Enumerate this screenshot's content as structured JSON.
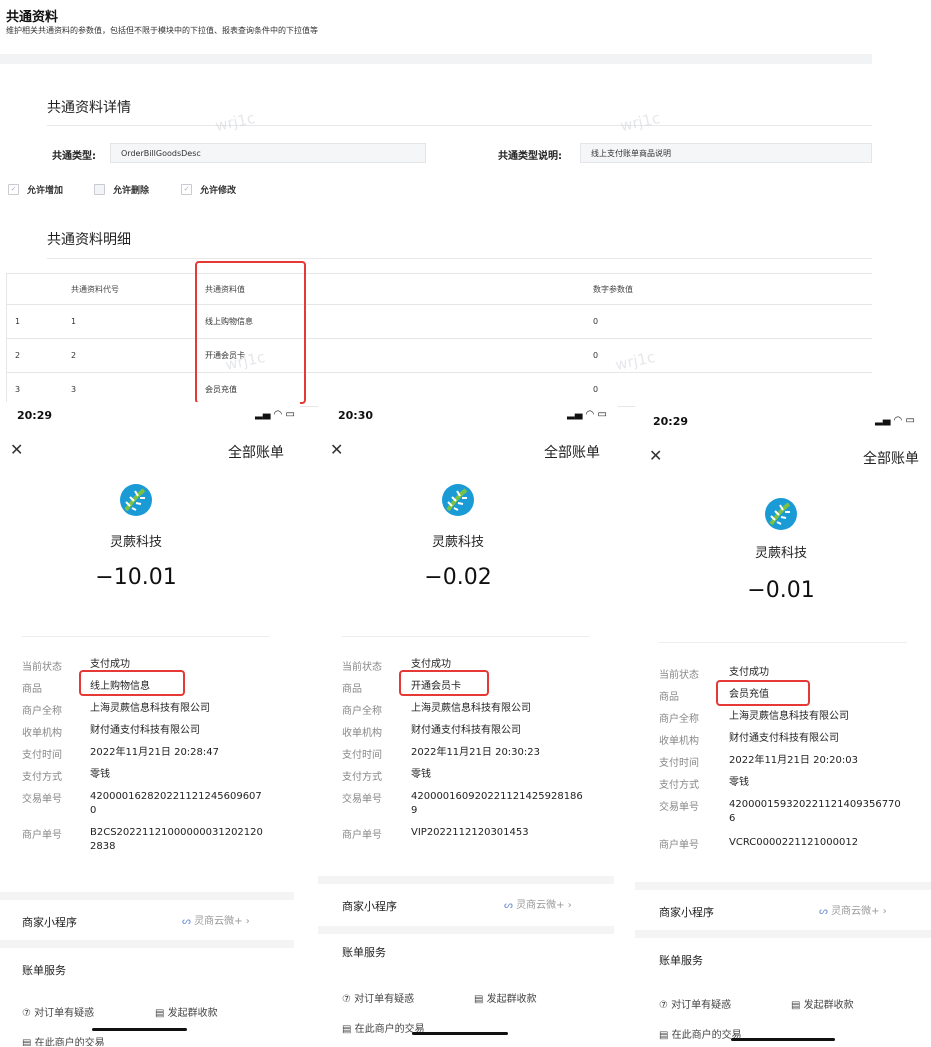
{
  "admin": {
    "title": "共通资料",
    "subtitle": "维护相关共通资料的参数值，包括但不限于模块中的下拉值、报表查询条件中的下拉值等",
    "detail_section": "共通资料详情",
    "type_label": "共通类型:",
    "type_value": "OrderBillGoodsDesc",
    "type_desc_label": "共通类型说明:",
    "type_desc_value": "线上支付账单商品说明",
    "checkboxes": [
      {
        "label": "允许增加",
        "checked": true
      },
      {
        "label": "允许删除",
        "checked": false
      },
      {
        "label": "允许修改",
        "checked": true
      }
    ],
    "detail_table_title": "共通资料明细",
    "watermark": "wrj1c",
    "columns": [
      "",
      "共通资料代号",
      "共通资料值",
      "数字参数值"
    ],
    "rows": [
      [
        "1",
        "1",
        "线上购物信息",
        "0"
      ],
      [
        "2",
        "2",
        "开通会员卡",
        "0"
      ],
      [
        "3",
        "3",
        "会员充值",
        "0"
      ]
    ]
  },
  "phones": [
    {
      "time": "20:29",
      "title": "全部账单",
      "merchant": "灵蕨科技",
      "amount": "−10.01",
      "labels": {
        "status": "当前状态",
        "goods": "商品",
        "merchant_name": "商户全称",
        "acquirer": "收单机构",
        "pay_time": "支付时间",
        "pay_method": "支付方式",
        "txn_no": "交易单号",
        "merchant_no": "商户单号"
      },
      "status": "支付成功",
      "goods": "线上购物信息",
      "merchant_name": "上海灵蕨信息科技有限公司",
      "acquirer": "财付通支付科技有限公司",
      "pay_time": "2022年11月21日 20:28:47",
      "pay_method": "零钱",
      "txn_no": "42000016282022112124560960 7 0",
      "txn_no_l1": "420000162820221121245609607",
      "txn_no_l2": "0",
      "merchant_no_l1": "B2CS2022112100000003120212 0",
      "merchant_no_l1b": "B2CS20221121000000031202120",
      "merchant_no_l2": "2838",
      "mini_label": "商家小程序",
      "mini_value": "灵商云微+",
      "bill_service": "账单服务",
      "act_query": "对订单有疑惑",
      "act_group": "发起群收款",
      "act_history": "在此商户的交易"
    },
    {
      "time": "20:30",
      "title": "全部账单",
      "merchant": "灵蕨科技",
      "amount": "−0.02",
      "status": "支付成功",
      "goods": "开通会员卡",
      "merchant_name": "上海灵蕨信息科技有限公司",
      "acquirer": "财付通支付科技有限公司",
      "pay_time": "2022年11月21日 20:30:23",
      "pay_method": "零钱",
      "txn_no_l1": "420000160920221121425928186",
      "txn_no_l2": "9",
      "merchant_no_l1": "VIP2022112120301453",
      "mini_label": "商家小程序",
      "mini_value": "灵商云微+",
      "bill_service": "账单服务",
      "act_query": "对订单有疑惑",
      "act_group": "发起群收款",
      "act_history": "在此商户的交易"
    },
    {
      "time": "20:29",
      "title": "全部账单",
      "merchant": "灵蕨科技",
      "amount": "−0.01",
      "status": "支付成功",
      "goods": "会员充值",
      "merchant_name": "上海灵蕨信息科技有限公司",
      "acquirer": "财付通支付科技有限公司",
      "pay_time": "2022年11月21日 20:20:03",
      "pay_method": "零钱",
      "txn_no_l1": "420000159320221121409356770",
      "txn_no_l2": "6",
      "merchant_no_l1": "VCRC0000221121000012",
      "mini_label": "商家小程序",
      "mini_value": "灵商云微+",
      "bill_service": "账单服务",
      "act_query": "对订单有疑惑",
      "act_group": "发起群收款",
      "act_history": "在此商户的交易"
    }
  ],
  "colors": {
    "highlight": "#e53935",
    "logo_blue": "#1a9bd6",
    "logo_leaf": "#7cc242"
  }
}
